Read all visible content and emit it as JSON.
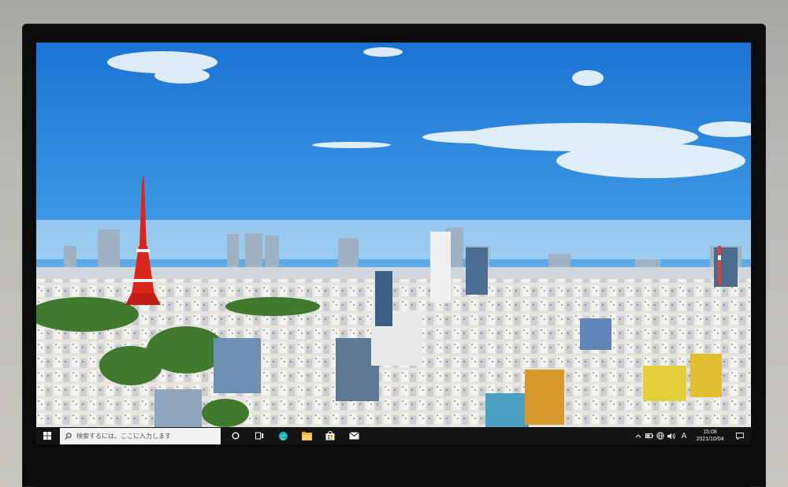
{
  "scene": "laptop-display",
  "taskbar": {
    "search_placeholder": "検索するには、ここに入力します",
    "pinned_icons": [
      "cortana-circle-icon",
      "task-view-icon",
      "edge-icon",
      "file-explorer-icon",
      "store-icon",
      "mail-icon"
    ],
    "tray": {
      "ime_label": "A",
      "time": "15:08",
      "date": "2021/10/04"
    }
  },
  "colors": {
    "taskbar": "#141414",
    "search_box": "#f2f2f2",
    "accent_tower": "#d8261c",
    "sky_top": "#1d78d6",
    "sky_bottom": "#a7d2f0"
  }
}
